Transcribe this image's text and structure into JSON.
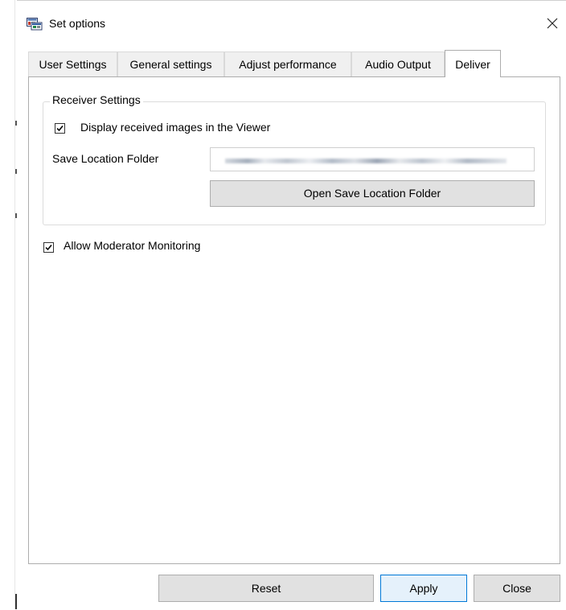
{
  "window": {
    "title": "Set options"
  },
  "tabs": [
    {
      "label": "User Settings",
      "active": false
    },
    {
      "label": "General settings",
      "active": false
    },
    {
      "label": "Adjust performance",
      "active": false
    },
    {
      "label": "Audio Output",
      "active": false
    },
    {
      "label": "Deliver",
      "active": true
    }
  ],
  "receiver_settings": {
    "group_title": "Receiver Settings",
    "display_received": {
      "label": "Display received images in the Viewer",
      "checked": true
    },
    "save_location_label": "Save Location Folder",
    "save_location_value": "",
    "open_folder_button": "Open Save Location Folder"
  },
  "moderator": {
    "label": "Allow Moderator Monitoring",
    "checked": true
  },
  "footer": {
    "reset": "Reset",
    "apply": "Apply",
    "close": "Close"
  },
  "icons": {
    "app": "options-window-icon",
    "close": "close-icon",
    "check": "checkmark-icon"
  },
  "colors": {
    "focus_border": "#0078d7",
    "button_face": "#e1e1e1",
    "tab_inactive": "#f0f0f0"
  }
}
